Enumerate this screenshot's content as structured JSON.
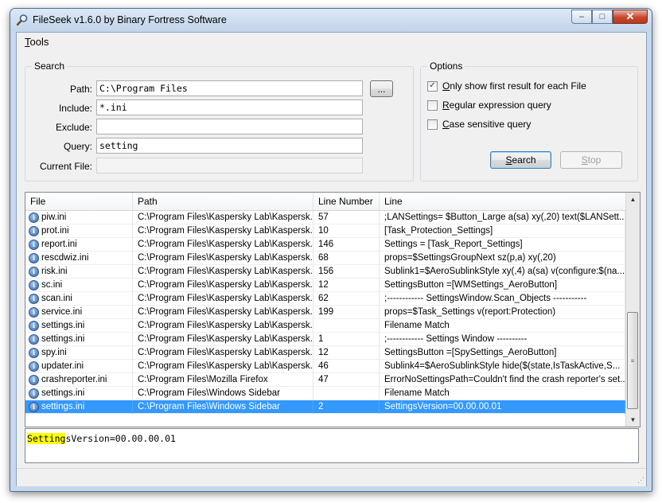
{
  "window": {
    "title": "FileSeek v1.6.0 by Binary Fortress Software",
    "controls": {
      "minimize": "–",
      "maximize": "□",
      "close": "✕"
    }
  },
  "menu": {
    "tools_prefix": "T",
    "tools_rest": "ools"
  },
  "search": {
    "group_title": "Search",
    "path_label": "Path:",
    "path_value": "C:\\Program Files",
    "browse_label": "...",
    "include_label": "Include:",
    "include_value": "*.ini",
    "exclude_label": "Exclude:",
    "exclude_value": "",
    "query_label": "Query:",
    "query_value": "setting",
    "current_file_label": "Current File:",
    "current_file_value": ""
  },
  "options": {
    "group_title": "Options",
    "first_result": {
      "prefix": "O",
      "rest": "nly show first result for each File",
      "checked": true
    },
    "regex": {
      "prefix": "R",
      "rest": "egular expression query",
      "checked": false
    },
    "case_sensitive": {
      "prefix": "C",
      "rest": "ase sensitive query",
      "checked": false
    },
    "search_button": {
      "prefix": "S",
      "rest": "earch"
    },
    "stop_button": {
      "prefix": "S",
      "rest": "top"
    }
  },
  "results": {
    "columns": [
      "File",
      "Path",
      "Line Number",
      "Line"
    ],
    "rows": [
      {
        "file": "piw.ini",
        "path": "C:\\Program Files\\Kaspersky Lab\\Kaspersk...",
        "line_number": "57",
        "line": ";LANSettings= $Button_Large a(sa) xy(,20) text($LANSett..."
      },
      {
        "file": "prot.ini",
        "path": "C:\\Program Files\\Kaspersky Lab\\Kaspersk...",
        "line_number": "10",
        "line": "[Task_Protection_Settings]"
      },
      {
        "file": "report.ini",
        "path": "C:\\Program Files\\Kaspersky Lab\\Kaspersk...",
        "line_number": "146",
        "line": "Settings    = [Task_Report_Settings]"
      },
      {
        "file": "rescdwiz.ini",
        "path": "C:\\Program Files\\Kaspersky Lab\\Kaspersk...",
        "line_number": "68",
        "line": "props=$SettingsGroupNext sz(p,a) xy(,20)"
      },
      {
        "file": "risk.ini",
        "path": "C:\\Program Files\\Kaspersky Lab\\Kaspersk...",
        "line_number": "156",
        "line": "Sublink1=$AeroSublinkStyle xy(,4) a(sa) v(configure:$(na..."
      },
      {
        "file": "sc.ini",
        "path": "C:\\Program Files\\Kaspersky Lab\\Kaspersk...",
        "line_number": "12",
        "line": "SettingsButton =[WMSettings_AeroButton]"
      },
      {
        "file": "scan.ini",
        "path": "C:\\Program Files\\Kaspersky Lab\\Kaspersk...",
        "line_number": "62",
        "line": ";------------ SettingsWindow.Scan_Objects -----------"
      },
      {
        "file": "service.ini",
        "path": "C:\\Program Files\\Kaspersky Lab\\Kaspersk...",
        "line_number": "199",
        "line": "props=$Task_Settings v(report:Protection)"
      },
      {
        "file": "settings.ini",
        "path": "C:\\Program Files\\Kaspersky Lab\\Kaspersk...",
        "line_number": "",
        "line": "Filename Match"
      },
      {
        "file": "settings.ini",
        "path": "C:\\Program Files\\Kaspersky Lab\\Kaspersk...",
        "line_number": "1",
        "line": ";------------ Settings Window ----------"
      },
      {
        "file": "spy.ini",
        "path": "C:\\Program Files\\Kaspersky Lab\\Kaspersk...",
        "line_number": "12",
        "line": "SettingsButton =[SpySettings_AeroButton]"
      },
      {
        "file": "updater.ini",
        "path": "C:\\Program Files\\Kaspersky Lab\\Kaspersk...",
        "line_number": "46",
        "line": "Sublink4=$AeroSublinkStyle hide($(state,IsTaskActive,S..."
      },
      {
        "file": "crashreporter.ini",
        "path": "C:\\Program Files\\Mozilla Firefox",
        "line_number": "47",
        "line": "ErrorNoSettingsPath=Couldn't find the crash reporter's set..."
      },
      {
        "file": "settings.ini",
        "path": "C:\\Program Files\\Windows Sidebar",
        "line_number": "",
        "line": "Filename Match"
      },
      {
        "file": "settings.ini",
        "path": "C:\\Program Files\\Windows Sidebar",
        "line_number": "2",
        "line": "SettingsVersion=00.00.00.01",
        "selected": true
      }
    ]
  },
  "preview": {
    "highlight": "Setting",
    "rest": "sVersion=00.00.00.01"
  },
  "colors": {
    "selection": "#3399ff",
    "highlight": "#ffff00",
    "title_bar": "#c8d8ec"
  }
}
